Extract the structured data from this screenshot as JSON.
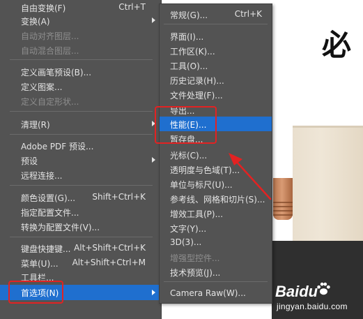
{
  "main_menu": {
    "items": [
      {
        "label": "自由变换(F)",
        "shortcut": "Ctrl+T",
        "disabled": false
      },
      {
        "label": "变换(A)",
        "shortcut": "",
        "disabled": false,
        "submenu": true
      },
      {
        "label": "自动对齐图层...",
        "shortcut": "",
        "disabled": true
      },
      {
        "label": "自动混合图层...",
        "shortcut": "",
        "disabled": true
      },
      {
        "label": "定义画笔预设(B)...",
        "shortcut": "",
        "disabled": false
      },
      {
        "label": "定义图案...",
        "shortcut": "",
        "disabled": false
      },
      {
        "label": "定义自定形状...",
        "shortcut": "",
        "disabled": true
      },
      {
        "label": "清理(R)",
        "shortcut": "",
        "disabled": false,
        "submenu": true
      },
      {
        "label": "Adobe PDF 预设...",
        "shortcut": "",
        "disabled": false
      },
      {
        "label": "预设",
        "shortcut": "",
        "disabled": false,
        "submenu": true
      },
      {
        "label": "远程连接...",
        "shortcut": "",
        "disabled": false
      },
      {
        "label": "颜色设置(G)...",
        "shortcut": "Shift+Ctrl+K",
        "disabled": false
      },
      {
        "label": "指定配置文件...",
        "shortcut": "",
        "disabled": false
      },
      {
        "label": "转换为配置文件(V)...",
        "shortcut": "",
        "disabled": false
      },
      {
        "label": "键盘快捷键...",
        "shortcut": "Alt+Shift+Ctrl+K",
        "disabled": false
      },
      {
        "label": "菜单(U)...",
        "shortcut": "Alt+Shift+Ctrl+M",
        "disabled": false
      },
      {
        "label": "工具栏...",
        "shortcut": "",
        "disabled": false
      },
      {
        "label": "首选项(N)",
        "shortcut": "",
        "disabled": false,
        "submenu": true,
        "highlighted": true
      }
    ]
  },
  "preferences_submenu": {
    "items": [
      {
        "label": "常规(G)...",
        "shortcut": "Ctrl+K",
        "disabled": false
      },
      {
        "label": "界面(I)...",
        "shortcut": "",
        "disabled": false
      },
      {
        "label": "工作区(K)...",
        "shortcut": "",
        "disabled": false
      },
      {
        "label": "工具(O)...",
        "shortcut": "",
        "disabled": false
      },
      {
        "label": "历史记录(H)...",
        "shortcut": "",
        "disabled": false
      },
      {
        "label": "文件处理(F)...",
        "shortcut": "",
        "disabled": false
      },
      {
        "label": "导出...",
        "shortcut": "",
        "disabled": false
      },
      {
        "label": "性能(E)...",
        "shortcut": "",
        "disabled": false,
        "highlighted": true
      },
      {
        "label": "暂存盘...",
        "shortcut": "",
        "disabled": false
      },
      {
        "label": "光标(C)...",
        "shortcut": "",
        "disabled": false
      },
      {
        "label": "透明度与色域(T)...",
        "shortcut": "",
        "disabled": false
      },
      {
        "label": "单位与标尺(U)...",
        "shortcut": "",
        "disabled": false
      },
      {
        "label": "参考线、网格和切片(S)...",
        "shortcut": "",
        "disabled": false
      },
      {
        "label": "增效工具(P)...",
        "shortcut": "",
        "disabled": false
      },
      {
        "label": "文字(Y)...",
        "shortcut": "",
        "disabled": false
      },
      {
        "label": "3D(3)...",
        "shortcut": "",
        "disabled": false
      },
      {
        "label": "增强型控件...",
        "shortcut": "",
        "disabled": true
      },
      {
        "label": "技术预览(J)...",
        "shortcut": "",
        "disabled": false
      },
      {
        "label": "Camera Raw(W)...",
        "shortcut": "",
        "disabled": false
      }
    ]
  },
  "canvas": {
    "art_character": "必"
  },
  "watermark": {
    "logo": "Baidu",
    "url": "jingyan.baidu.com"
  },
  "colors": {
    "menu_bg": "#535353",
    "highlight": "#1f6fcf",
    "annotation": "#e32222"
  }
}
